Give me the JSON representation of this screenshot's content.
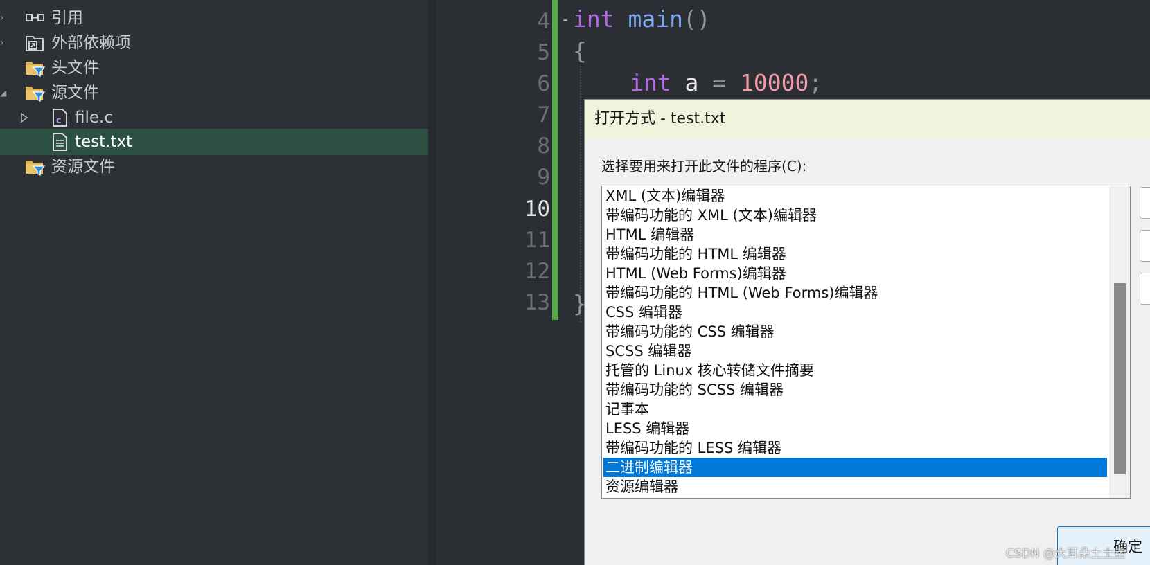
{
  "explorer": {
    "items": [
      {
        "label": "引用",
        "icon": "references-icon"
      },
      {
        "label": "外部依赖项",
        "icon": "external-dependencies-icon"
      },
      {
        "label": "头文件",
        "icon": "filter-folder-icon"
      },
      {
        "label": "源文件",
        "icon": "filter-folder-icon"
      },
      {
        "label": "file.c",
        "icon": "c-file-icon"
      },
      {
        "label": "test.txt",
        "icon": "text-file-icon"
      },
      {
        "label": "资源文件",
        "icon": "filter-folder-icon"
      }
    ],
    "selected": "test.txt"
  },
  "editor": {
    "line_numbers": [
      "4",
      "5",
      "6",
      "7",
      "8",
      "9",
      "10",
      "11",
      "12",
      "13"
    ],
    "current_line": "10",
    "code": {
      "line4_kw": "int",
      "line4_fn": "main",
      "line4_parens": "()",
      "line5_brace": "{",
      "line6_kw": "int",
      "line6_var": "a",
      "line6_eq": "=",
      "line6_num": "10000",
      "line6_semi": ";",
      "line13_brace": "}"
    },
    "colors": {
      "change_bar": "#57a64a",
      "keyword": "#b267e6",
      "function": "#7aa8f4",
      "number": "#f29aa7"
    }
  },
  "dialog": {
    "title": "打开方式 - test.txt",
    "prompt": "选择要用来打开此文件的程序(C):",
    "programs": [
      "XML (文本)编辑器",
      "带编码功能的 XML (文本)编辑器",
      "HTML 编辑器",
      "带编码功能的 HTML 编辑器",
      "HTML (Web Forms)编辑器",
      "带编码功能的 HTML (Web Forms)编辑器",
      "CSS 编辑器",
      "带编码功能的 CSS 编辑器",
      "SCSS 编辑器",
      "托管的 Linux 核心转储文件摘要",
      "带编码功能的 SCSS 编辑器",
      "记事本",
      "LESS 编辑器",
      "带编码功能的 LESS 编辑器",
      "二进制编辑器",
      "资源编辑器"
    ],
    "selected_program": "二进制编辑器",
    "ok_label": "确定",
    "colors": {
      "titlebar": "#eef5dc",
      "selection": "#0078d7"
    }
  },
  "watermark": "CSDN @大耳朵土土垚"
}
